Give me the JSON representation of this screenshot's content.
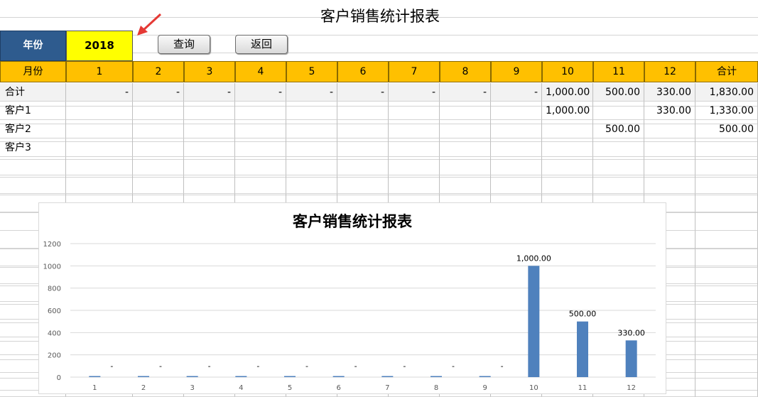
{
  "title": "客户销售统计报表",
  "year": {
    "label": "年份",
    "value": "2018"
  },
  "buttons": {
    "query": "查询",
    "back": "返回"
  },
  "table": {
    "header_label": "月份",
    "months": [
      "1",
      "2",
      "3",
      "4",
      "5",
      "6",
      "7",
      "8",
      "9",
      "10",
      "11",
      "12"
    ],
    "total_label": "合计",
    "rows": [
      {
        "name": "合计",
        "cells": [
          "-",
          "-",
          "-",
          "-",
          "-",
          "-",
          "-",
          "-",
          "-",
          "1,000.00",
          "500.00",
          "330.00"
        ],
        "total": "1,830.00"
      },
      {
        "name": "客户1",
        "cells": [
          "",
          "",
          "",
          "",
          "",
          "",
          "",
          "",
          "",
          "1,000.00",
          "",
          "330.00"
        ],
        "total": "1,330.00"
      },
      {
        "name": "客户2",
        "cells": [
          "",
          "",
          "",
          "",
          "",
          "",
          "",
          "",
          "",
          "",
          "500.00",
          ""
        ],
        "total": "500.00"
      },
      {
        "name": "客户3",
        "cells": [
          "",
          "",
          "",
          "",
          "",
          "",
          "",
          "",
          "",
          "",
          "",
          ""
        ],
        "total": ""
      }
    ]
  },
  "chart_data": {
    "type": "bar",
    "title": "客户销售统计报表",
    "categories": [
      "1",
      "2",
      "3",
      "4",
      "5",
      "6",
      "7",
      "8",
      "9",
      "10",
      "11",
      "12"
    ],
    "series": [
      {
        "values": [
          0,
          0,
          0,
          0,
          0,
          0,
          0,
          0,
          0,
          1000,
          500,
          330
        ]
      }
    ],
    "data_labels": [
      "-",
      "-",
      "-",
      "-",
      "-",
      "-",
      "-",
      "-",
      "-",
      "1,000.00",
      "500.00",
      "330.00"
    ],
    "yticks": [
      "0",
      "200",
      "400",
      "600",
      "800",
      "1000",
      "1200"
    ],
    "ylim": [
      0,
      1200
    ],
    "grid": true,
    "bar_color": "#4f81bd"
  },
  "colors": {
    "header": "#ffc000",
    "year_label_bg": "#2e5b8e",
    "year_value_bg": "#ffff00",
    "arrow": "#e53935"
  },
  "icons": {
    "annotation": "red-arrow-icon"
  }
}
